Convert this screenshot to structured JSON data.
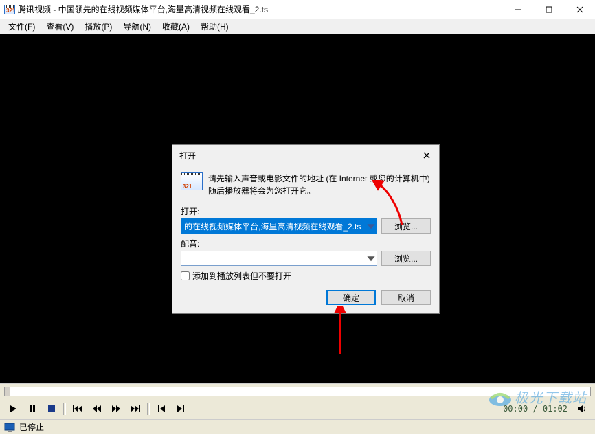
{
  "window": {
    "title": "腾讯视频 - 中国领先的在线视频媒体平台,海量高清视频在线观看_2.ts"
  },
  "menu": {
    "file": "文件(F)",
    "view": "查看(V)",
    "play": "播放(P)",
    "navigate": "导航(N)",
    "favorites": "收藏(A)",
    "help": "帮助(H)"
  },
  "dialog": {
    "title": "打开",
    "instruction": "请先输入声音或电影文件的地址 (在 Internet 或您的计算机中) 随后播放器将会为您打开它。",
    "open_label": "打开:",
    "open_value": "的在线视频媒体平台,海里高清视频在线观看_2.ts",
    "dub_label": "配音:",
    "dub_value": "",
    "browse1": "浏览...",
    "browse2": "浏览...",
    "add_no_open": "添加到播放列表但不要打开",
    "ok": "确定",
    "cancel": "取消"
  },
  "controls": {
    "time": "00:00 / 01:02"
  },
  "status": {
    "text": "已停止"
  },
  "watermark": {
    "text": "极光下载站"
  }
}
